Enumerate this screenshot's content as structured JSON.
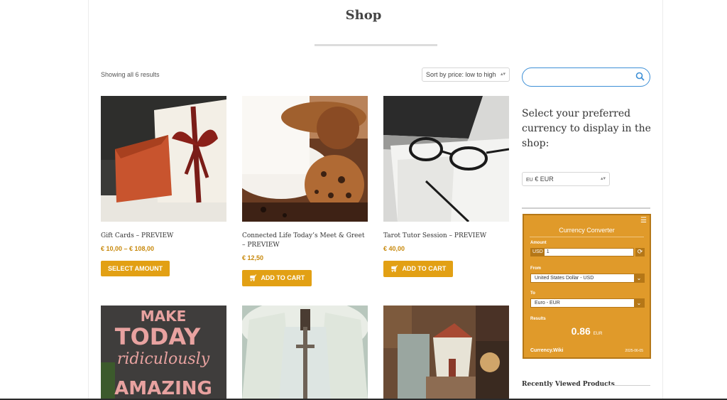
{
  "page": {
    "title": "Shop"
  },
  "toolbar": {
    "result_count": "Showing all 6 results",
    "sort_label": "Sort by price: low to high"
  },
  "products": [
    {
      "name": "Gift Cards – PREVIEW",
      "price": "€ 10,00 – € 108,00",
      "button": "SELECT AMOUNT"
    },
    {
      "name": "Connected Life Today’s Meet & Greet – PREVIEW",
      "price": "€ 12,50",
      "button": "ADD TO CART"
    },
    {
      "name": "Tarot Tutor Session – PREVIEW",
      "price": "€ 40,00",
      "button": "ADD TO CART"
    }
  ],
  "second_row": {
    "make_today": {
      "l1": "MAKE",
      "l2": "TODAY",
      "l3": "ridiculously",
      "l4": "AMAZING"
    }
  },
  "sidebar": {
    "search_placeholder": "",
    "currency_prompt": "Select your preferred currency to display in the shop:",
    "currency_flag": "EU",
    "currency_selected": "€ EUR",
    "recent_title": "Recently Viewed Products"
  },
  "converter": {
    "title": "Currency Converter",
    "amount_label": "Amount",
    "amount_currency": "USD",
    "amount_value": "1",
    "from_label": "From",
    "from_value": "United States Dollar - USD",
    "to_label": "To",
    "to_value": "Euro - EUR",
    "results_label": "Results",
    "result_value": "0.86",
    "result_unit": "EUR",
    "footer_brand": "Currency.Wiki",
    "footer_date": "2025-06-05"
  },
  "colors": {
    "accent": "#e2a014",
    "price": "#c8890d",
    "converter_bg": "#e09a2a",
    "search_border": "#3d8fd6"
  },
  "icons": [
    "search-icon",
    "cart-icon",
    "refresh-icon",
    "chevron-down-icon",
    "list-icon"
  ]
}
